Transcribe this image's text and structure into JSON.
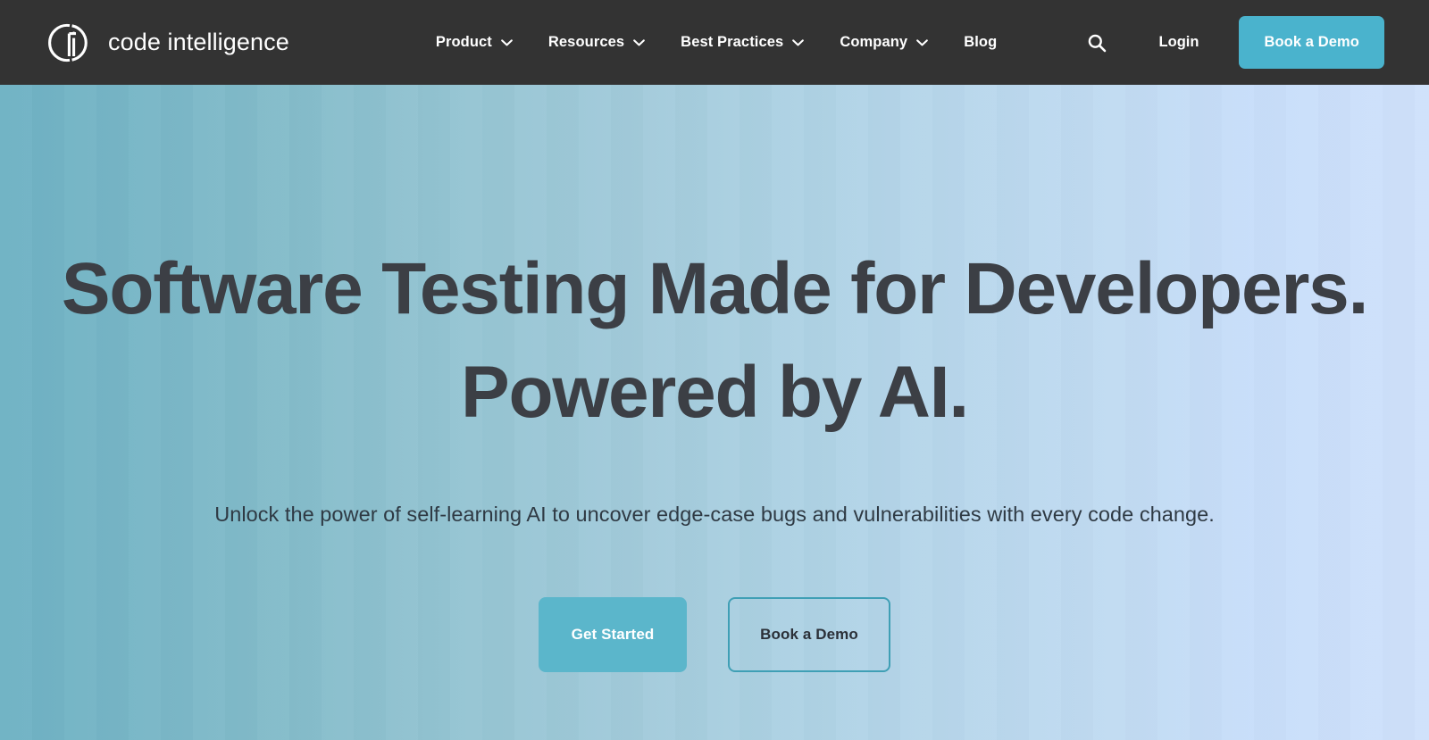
{
  "header": {
    "brand": {
      "name": "code intelligence",
      "logo_icon": "ci-monogram-logo"
    },
    "nav": [
      {
        "label": "Product",
        "has_dropdown": true,
        "icon": "chevron-down-icon"
      },
      {
        "label": "Resources",
        "has_dropdown": true,
        "icon": "chevron-down-icon"
      },
      {
        "label": "Best Practices",
        "has_dropdown": true,
        "icon": "chevron-down-icon"
      },
      {
        "label": "Company",
        "has_dropdown": true,
        "icon": "chevron-down-icon"
      },
      {
        "label": "Blog",
        "has_dropdown": false,
        "icon": ""
      }
    ],
    "search_icon": "search-icon",
    "login_label": "Login",
    "demo_label": "Book a Demo",
    "bar_color": "#333333",
    "accent_color": "#4ab3cd"
  },
  "hero": {
    "headline_line1": "Software Testing Made for Developers.",
    "headline_line2": "Powered by AI.",
    "subheadline": "Unlock the power of self-learning AI to uncover edge-case bugs and vulnerabilities with every code change.",
    "primary_cta": "Get Started",
    "secondary_cta": "Book a Demo",
    "gradient_start": "#6fb2c4",
    "gradient_end": "#cfe1fb",
    "headline_color": "#3c3f45",
    "primary_cta_color": "#5bb6cb",
    "secondary_cta_border": "#3f9fb5"
  }
}
